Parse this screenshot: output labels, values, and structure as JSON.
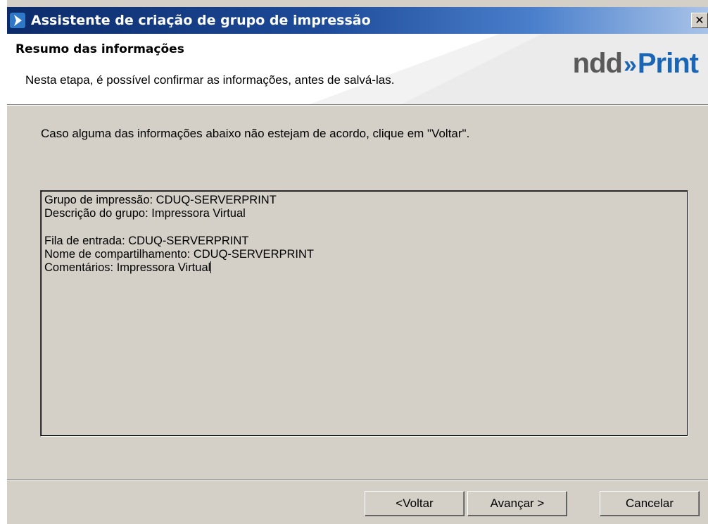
{
  "window": {
    "title": "Assistente de criação de grupo de impressão",
    "close_glyph": "✕"
  },
  "header": {
    "title": "Resumo das informações",
    "subtitle": "Nesta etapa, é possível confirmar as informações, antes de salvá-las.",
    "brand": {
      "part1": "ndd",
      "arrows": "»",
      "part2": "Print"
    }
  },
  "main": {
    "instruction": "Caso alguma das informações abaixo não estejam de acordo, clique em \"Voltar\".",
    "summary": {
      "group_line": "Grupo de impressão: CDUQ-SERVERPRINT",
      "description_line": "Descrição do grupo: Impressora Virtual",
      "queue_line": "Fila de entrada: CDUQ-SERVERPRINT",
      "share_line": "Nome de compartilhamento: CDUQ-SERVERPRINT",
      "comments_line": "Comentários: Impressora Virtual"
    }
  },
  "footer": {
    "back_label": "<Voltar",
    "next_label": "Avançar >",
    "cancel_label": "Cancelar"
  },
  "colors": {
    "brand_blue": "#1a66b5",
    "brand_gray": "#5a5a5a",
    "dialog_face": "#d4d0c8"
  }
}
